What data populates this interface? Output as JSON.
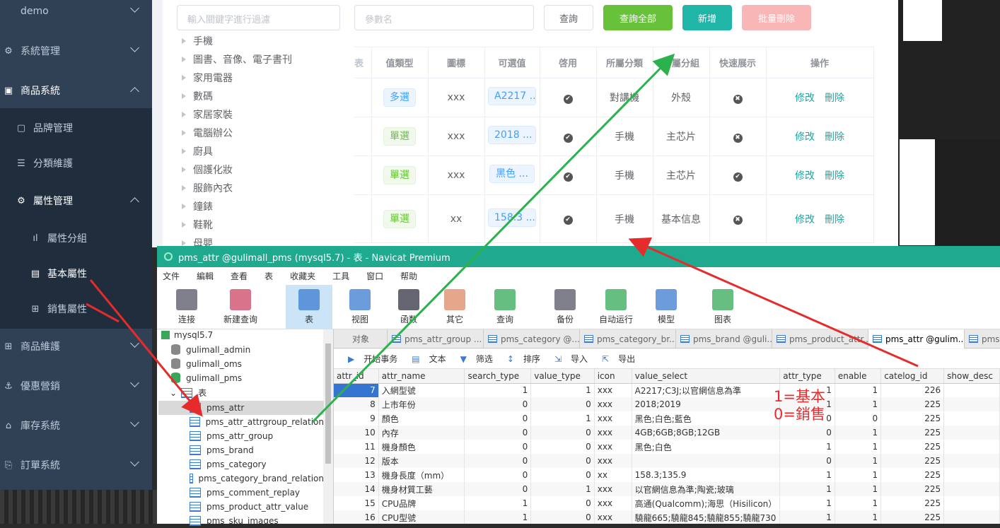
{
  "sidebar": {
    "items": [
      {
        "label": "demo",
        "icon": "none"
      },
      {
        "label": "系統管理",
        "icon": "gear-icon"
      },
      {
        "label": "商品系統",
        "icon": "monitor-icon"
      },
      {
        "label": "品牌管理",
        "icon": "square-icon"
      },
      {
        "label": "分類維護",
        "icon": "list-icon"
      },
      {
        "label": "屬性管理",
        "icon": "gear-icon"
      },
      {
        "label": "屬性分組",
        "icon": "bar-chart-icon"
      },
      {
        "label": "基本屬性",
        "icon": "document-icon"
      },
      {
        "label": "銷售屬性",
        "icon": "grid-icon"
      },
      {
        "label": "商品維護",
        "icon": "grid-icon"
      },
      {
        "label": "優惠營銷",
        "icon": "anchor-icon"
      },
      {
        "label": "庫存系統",
        "icon": "home-icon"
      },
      {
        "label": "訂單系統",
        "icon": "invoice-icon"
      }
    ]
  },
  "web": {
    "filter_placeholder": "輸入關鍵字進行過濾",
    "param_placeholder": "參數名",
    "buttons": {
      "query": "查詢",
      "query_all": "查詢全部",
      "add": "新增",
      "batch_delete": "批量刪除"
    },
    "tree": [
      "手機",
      "圖書、音像、電子書刊",
      "家用電器",
      "數碼",
      "家居家裝",
      "電腦辦公",
      "廚具",
      "個護化妝",
      "服飾內衣",
      "鐘錶",
      "鞋靴",
      "母嬰"
    ],
    "columns": [
      "表",
      "值類型",
      "圖標",
      "可選值",
      "啓用",
      "所屬分類",
      "所屬分組",
      "快速展示",
      "操作"
    ],
    "rows": [
      {
        "value_type": "多選",
        "icon": "xxx",
        "values": "A2217 ...",
        "enable": true,
        "category": "對講機",
        "group": "外殼",
        "quick": false
      },
      {
        "value_type": "單選",
        "icon": "xxx",
        "values": "2018 ...",
        "enable": true,
        "category": "手機",
        "group": "主芯片",
        "quick": false
      },
      {
        "value_type": "單選",
        "icon": "xxx",
        "values": "黑色 ...",
        "enable": true,
        "category": "手機",
        "group": "主芯片",
        "quick": true
      },
      {
        "value_type": "單選",
        "icon": "xx",
        "values": "158.3 ...",
        "enable": true,
        "category": "手機",
        "group": "基本信息",
        "quick": false
      }
    ],
    "actions": {
      "edit": "修改",
      "delete": "刪除"
    }
  },
  "navicat": {
    "title": "pms_attr @gulimall_pms (mysql5.7) - 表 - Navicat Premium",
    "menu": [
      "文件",
      "編輯",
      "查看",
      "表",
      "收藏夹",
      "工具",
      "窗口",
      "帮助"
    ],
    "toolbar": [
      "连接",
      "新建查询",
      "表",
      "视图",
      "函数",
      "其它",
      "查询",
      "备份",
      "自动运行",
      "模型",
      "图表"
    ],
    "tree": {
      "connection": "mysql5.7",
      "dbs": [
        "gulimall_admin",
        "gulimall_oms",
        "gulimall_pms"
      ],
      "tables_label": "表",
      "tables": [
        "pms_attr",
        "pms_attr_attrgroup_relation",
        "pms_attr_group",
        "pms_brand",
        "pms_category",
        "pms_category_brand_relation",
        "pms_comment_replay",
        "pms_product_attr_value",
        "pms_sku_images"
      ]
    },
    "tabs": [
      "对象",
      "pms_attr_group ...",
      "pms_category @...",
      "pms_category_br...",
      "pms_brand @guli...",
      "pms_product_attr...",
      "pms_attr @gulim...",
      "pms"
    ],
    "subtoolbar": [
      "开始事务",
      "文本",
      "筛选",
      "排序",
      "导入",
      "导出"
    ],
    "grid_columns": [
      "attr_id",
      "attr_name",
      "search_type",
      "value_type",
      "icon",
      "value_select",
      "attr_type",
      "enable",
      "catelog_id",
      "show_desc"
    ],
    "grid_rows": [
      [
        "7",
        "入網型號",
        "1",
        "1",
        "xxx",
        "A2217;C3J;以官網信息為準",
        "1",
        "1",
        "226"
      ],
      [
        "8",
        "上市年份",
        "0",
        "0",
        "xxx",
        "2018;2019",
        "1",
        "1",
        "225"
      ],
      [
        "9",
        "顏色",
        "0",
        "1",
        "xxx",
        "黑色;白色;藍色",
        "0",
        "0",
        "225"
      ],
      [
        "10",
        "內存",
        "0",
        "0",
        "xxx",
        "4GB;6GB;8GB;12GB",
        "0",
        "1",
        "225"
      ],
      [
        "11",
        "機身顏色",
        "0",
        "0",
        "xxx",
        "黑色;白色",
        "1",
        "1",
        "225"
      ],
      [
        "12",
        "版本",
        "0",
        "0",
        "xxx",
        "",
        "0",
        "1",
        "225"
      ],
      [
        "13",
        "機身長度（mm）",
        "0",
        "0",
        "xx",
        "158.3;135.9",
        "1",
        "1",
        "225"
      ],
      [
        "14",
        "機身材質工藝",
        "0",
        "1",
        "xxx",
        "以官網信息為準;陶瓷;玻璃",
        "1",
        "1",
        "225"
      ],
      [
        "15",
        "CPU品牌",
        "1",
        "0",
        "xxx",
        "高通(Qualcomm);海思（Hisilicon）",
        "1",
        "1",
        "225"
      ],
      [
        "16",
        "CPU型號",
        "1",
        "0",
        "xxx",
        "驍龍665;驍龍845;驍龍855;驍龍730",
        "1",
        "1",
        "225"
      ]
    ]
  },
  "annotation": {
    "line1": "1=基本",
    "line2": "0=銷售",
    "color": "#e52b2b"
  },
  "colors": {
    "sidebar": "#304156",
    "navicat_title": "#1faa8f",
    "query_all": "#67c23a",
    "add": "#1fb5a7",
    "batch_delete": "#f9b6b6"
  }
}
